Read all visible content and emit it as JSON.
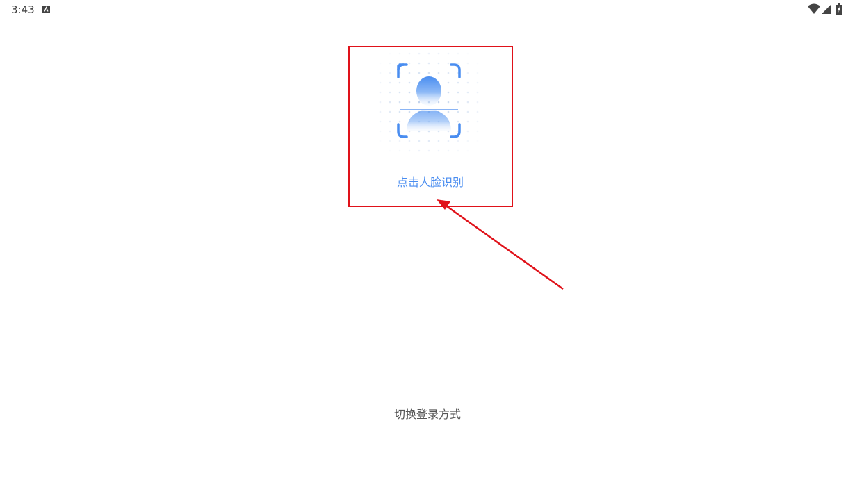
{
  "status_bar": {
    "time": "3:43",
    "icons": [
      "notification-a-icon",
      "wifi-icon",
      "cellular-signal-icon",
      "battery-charging-icon"
    ]
  },
  "face_login": {
    "label": "点击人脸识别",
    "illustration": "face-scan-icon",
    "accent_color": "#4a8df0"
  },
  "switch_login": {
    "label": "切换登录方式"
  },
  "annotation": {
    "highlight_color": "#e0121a"
  }
}
